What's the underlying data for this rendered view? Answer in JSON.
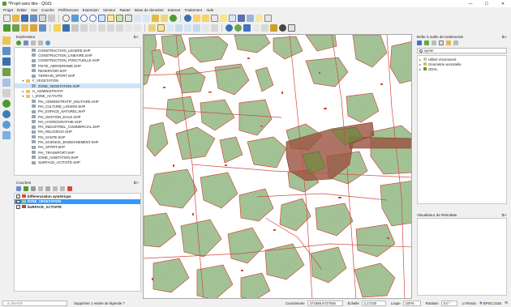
{
  "window": {
    "title": "*Projet sans titre - QGIS",
    "controls": [
      "—",
      "☐",
      "✕"
    ]
  },
  "menu": [
    "Projet",
    "Éditer",
    "Vue",
    "Couche",
    "Préférences",
    "Extension",
    "Vecteur",
    "Raster",
    "Base de données",
    "Internet",
    "Traitement",
    "Aide"
  ],
  "colors": {
    "green_zone": "#a4c497",
    "green_stroke": "#5d8a4e",
    "red_line": "#d0493f",
    "brown_activity": "#9a5140",
    "selection_blue": "#3399ff"
  },
  "explorer": {
    "title": "Explorateur",
    "items": [
      {
        "label": "CONSTRUCTION_LEGERE.SHP",
        "kind": "file",
        "indent": 3
      },
      {
        "label": "CONSTRUCTION_LINEAIRE.SHP",
        "kind": "file",
        "indent": 3
      },
      {
        "label": "CONSTRUCTION_PONCTUELLE.SHP",
        "kind": "file",
        "indent": 3
      },
      {
        "label": "PISTE_AERODROME.SHP",
        "kind": "file",
        "indent": 3
      },
      {
        "label": "RESERVOIR.SHP",
        "kind": "file",
        "indent": 3
      },
      {
        "label": "TERRAIN_SPORT.SHP",
        "kind": "file",
        "indent": 3
      },
      {
        "label": "F_VEGETATION",
        "kind": "folder",
        "indent": 2,
        "arrow": "▾"
      },
      {
        "label": "ZONE_VEGETATION.SHP",
        "kind": "file",
        "indent": 3,
        "selected": true
      },
      {
        "label": "H_ADMINISTRATIF",
        "kind": "folder",
        "indent": 2,
        "arrow": "▸"
      },
      {
        "label": "I_ZONE_ACTIVITE",
        "kind": "folder",
        "indent": 2,
        "arrow": "▾"
      },
      {
        "label": "PAI_ADMINISTRATIF_MILITAIRE.SHP",
        "kind": "file",
        "indent": 3
      },
      {
        "label": "PAI_CULTURE_LOISIRS.SHP",
        "kind": "file",
        "indent": 3
      },
      {
        "label": "PAI_ESPACE_NATUREL.SHP",
        "kind": "file",
        "indent": 3
      },
      {
        "label": "PAI_GESTION_EAUX.SHP",
        "kind": "file",
        "indent": 3
      },
      {
        "label": "PAI_HYDROGRAPHIE.SHP",
        "kind": "file",
        "indent": 3
      },
      {
        "label": "PAI_INDUSTRIEL_COMMERCIAL.SHP",
        "kind": "file",
        "indent": 3
      },
      {
        "label": "PAI_RELIGIEUX.SHP",
        "kind": "file",
        "indent": 3
      },
      {
        "label": "PAI_SANTE.SHP",
        "kind": "file",
        "indent": 3
      },
      {
        "label": "PAI_SCIENCE_ENSEIGNEMENT.SHP",
        "kind": "file",
        "indent": 3
      },
      {
        "label": "PAI_SPORT.SHP",
        "kind": "file",
        "indent": 3
      },
      {
        "label": "PAI_TRANSPORT.SHP",
        "kind": "file",
        "indent": 3
      },
      {
        "label": "ZONE_HABITATION.SHP",
        "kind": "file",
        "indent": 3
      },
      {
        "label": "SURFACE_ACTIVITE.SHP",
        "kind": "file",
        "indent": 3
      }
    ]
  },
  "layers": {
    "title": "Couches",
    "items": [
      {
        "label": "Différenciation symétrique",
        "swatch": "#d0493f",
        "checked": true,
        "selected": false
      },
      {
        "label": "ZONE_VEGETATION",
        "swatch": "#a4c497",
        "checked": true,
        "selected": true
      },
      {
        "label": "SURFACE_ACTIVITE",
        "swatch": "#9a5140",
        "checked": true,
        "selected": false
      }
    ]
  },
  "toolbox": {
    "title": "Boîte à outils de traitements",
    "search_value": "symm",
    "items": [
      {
        "label": "Utilisé récemment",
        "icon": "clock-icon"
      },
      {
        "label": "Géométrie vectorielle",
        "icon": "vector-icon"
      },
      {
        "label": "GDAL",
        "icon": "gdal-icon"
      }
    ]
  },
  "results": {
    "title": "Visualiseur de Résultats"
  },
  "statusbar": {
    "locator_placeholder": "a cherché",
    "message": "Supprimer 1 entrée de légende ?",
    "coord_label": "Coordonnée",
    "coord_value": "471659,6737646",
    "scale_label": "Échelle",
    "scale_value": "1:17220",
    "zoom_label": "Loupe",
    "zoom_value": "100%",
    "rotation_label": "Rotation",
    "rotation_value": "0,0 °",
    "render_label": "Rendu",
    "crs_value": "EPSG:2154"
  }
}
